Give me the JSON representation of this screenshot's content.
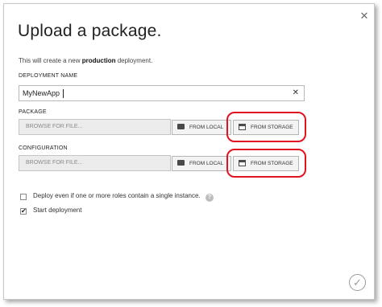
{
  "dialog": {
    "close_glyph": "✕",
    "title": "Upload a package.",
    "subtitle_prefix": "This will create a new ",
    "subtitle_bold": "production",
    "subtitle_suffix": " deployment."
  },
  "deployment_name": {
    "label": "DEPLOYMENT NAME",
    "value": "MyNewApp",
    "clear_glyph": "✕"
  },
  "package": {
    "label": "PACKAGE",
    "browse_placeholder": "BROWSE FOR FILE...",
    "from_local_label": "FROM LOCAL",
    "from_storage_label": "FROM STORAGE"
  },
  "configuration": {
    "label": "CONFIGURATION",
    "browse_placeholder": "BROWSE FOR FILE...",
    "from_local_label": "FROM LOCAL",
    "from_storage_label": "FROM STORAGE"
  },
  "options": {
    "deploy_even_if_single": {
      "label": "Deploy even if one or more roles contain a single instance.",
      "checked": false
    },
    "start_deployment": {
      "label": "Start deployment",
      "checked": true,
      "check_glyph": "✔"
    },
    "help_glyph": "?"
  },
  "footer": {
    "ok_glyph": "✓"
  },
  "colors": {
    "highlight": "#e0141e"
  }
}
